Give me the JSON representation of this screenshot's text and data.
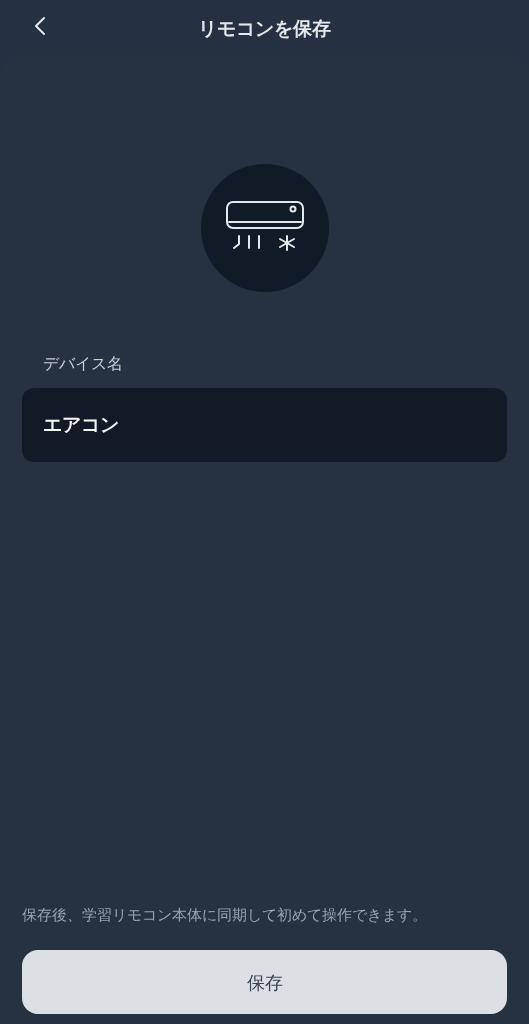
{
  "header": {
    "title": "リモコンを保存"
  },
  "device_name": {
    "label": "デバイス名",
    "value": "エアコン"
  },
  "note": "保存後、学習リモコン本体に同期して初めて操作できます。",
  "buttons": [
    {
      "label": "保存"
    }
  ]
}
